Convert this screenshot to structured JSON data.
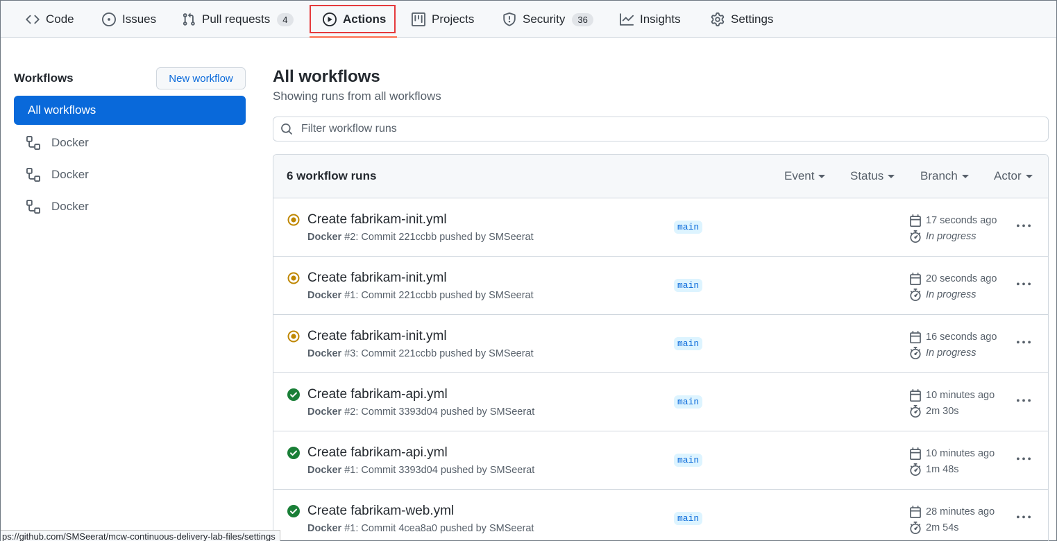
{
  "nav": {
    "tabs": [
      {
        "label": "Code",
        "icon": "code-icon"
      },
      {
        "label": "Issues",
        "icon": "issue-opened-icon"
      },
      {
        "label": "Pull requests",
        "icon": "git-pull-request-icon",
        "count": "4"
      },
      {
        "label": "Actions",
        "icon": "play-icon",
        "active": true
      },
      {
        "label": "Projects",
        "icon": "table-icon"
      },
      {
        "label": "Security",
        "icon": "shield-icon",
        "count": "36"
      },
      {
        "label": "Insights",
        "icon": "graph-icon"
      },
      {
        "label": "Settings",
        "icon": "gear-icon"
      }
    ]
  },
  "sidebar": {
    "title": "Workflows",
    "new_workflow_label": "New workflow",
    "all_workflows_label": "All workflows",
    "items": [
      {
        "label": "Docker",
        "icon": "workflow-icon"
      },
      {
        "label": "Docker",
        "icon": "workflow-icon"
      },
      {
        "label": "Docker",
        "icon": "workflow-icon"
      }
    ]
  },
  "main": {
    "title": "All workflows",
    "subtitle": "Showing runs from all workflows",
    "filter_placeholder": "Filter workflow runs",
    "runs_count": "6 workflow runs",
    "filters": [
      "Event",
      "Status",
      "Branch",
      "Actor"
    ],
    "runs": [
      {
        "status": "in-progress",
        "title": "Create fabrikam-init.yml",
        "workflow": "Docker",
        "meta": " #2: Commit 221ccbb pushed by SMSeerat",
        "branch": "main",
        "when": "17 seconds ago",
        "duration": "In progress"
      },
      {
        "status": "in-progress",
        "title": "Create fabrikam-init.yml",
        "workflow": "Docker",
        "meta": " #1: Commit 221ccbb pushed by SMSeerat",
        "branch": "main",
        "when": "20 seconds ago",
        "duration": "In progress"
      },
      {
        "status": "in-progress",
        "title": "Create fabrikam-init.yml",
        "workflow": "Docker",
        "meta": " #3: Commit 221ccbb pushed by SMSeerat",
        "branch": "main",
        "when": "16 seconds ago",
        "duration": "In progress"
      },
      {
        "status": "success",
        "title": "Create fabrikam-api.yml",
        "workflow": "Docker",
        "meta": " #2: Commit 3393d04 pushed by SMSeerat",
        "branch": "main",
        "when": "10 minutes ago",
        "duration": "2m 30s"
      },
      {
        "status": "success",
        "title": "Create fabrikam-api.yml",
        "workflow": "Docker",
        "meta": " #1: Commit 3393d04 pushed by SMSeerat",
        "branch": "main",
        "when": "10 minutes ago",
        "duration": "1m 48s"
      },
      {
        "status": "success",
        "title": "Create fabrikam-web.yml",
        "workflow": "Docker",
        "meta": " #1: Commit 4cea8a0 pushed by SMSeerat",
        "branch": "main",
        "when": "28 minutes ago",
        "duration": "2m 54s"
      }
    ]
  },
  "statusbar": {
    "url": "ps://github.com/SMSeerat/mcw-continuous-delivery-lab-files/settings"
  },
  "colors": {
    "accent": "#0969da",
    "in_progress": "#bf8700",
    "success": "#1a7f37",
    "highlight_box": "#e5393c"
  }
}
